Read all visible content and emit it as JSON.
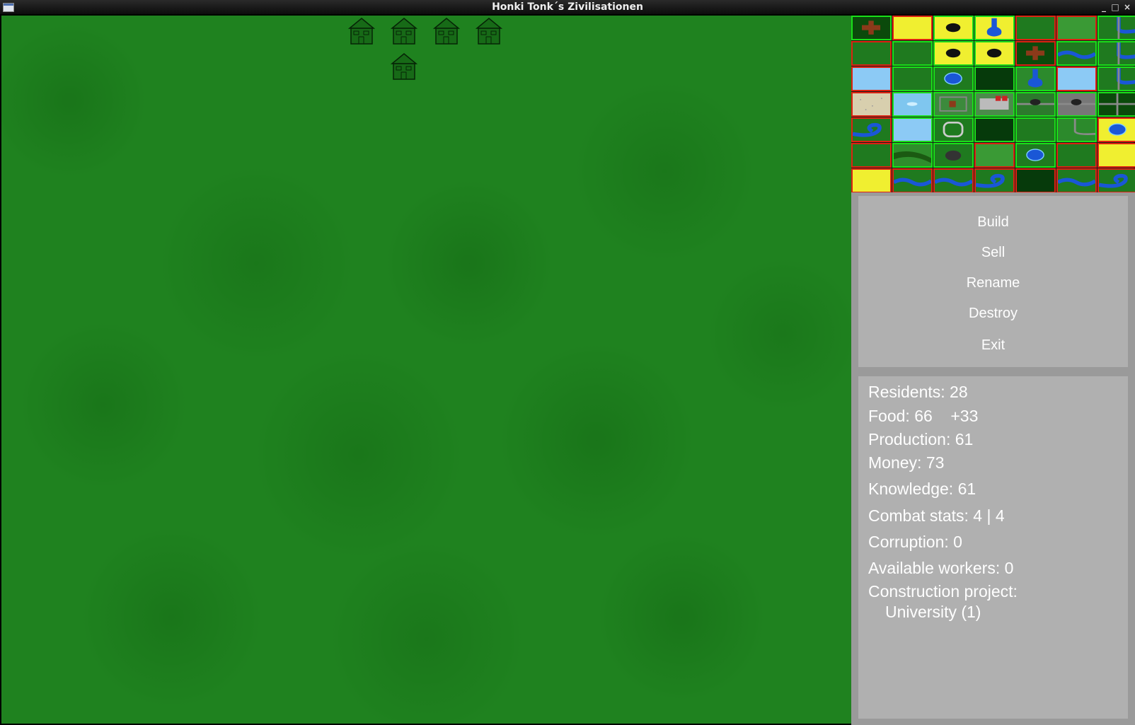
{
  "window": {
    "title": "Honki Tonk´s Zivilisationen",
    "controls": {
      "minimize": "_",
      "maximize": "□",
      "close": "×"
    }
  },
  "map": {
    "background": "#1f821f",
    "buildings": [
      {
        "icon": "house-icon"
      },
      {
        "icon": "house-icon"
      },
      {
        "icon": "house-icon"
      },
      {
        "icon": "house-icon"
      },
      {
        "icon": "house-icon"
      }
    ]
  },
  "minimap": {
    "rows": [
      [
        "cross-own",
        "sand",
        "oil",
        "lake-sand",
        "grass",
        "grass-light",
        "river-corner-own"
      ],
      [
        "grass",
        "grass",
        "oil-sand",
        "oil",
        "cross-road",
        "river",
        "river-road"
      ],
      [
        "water-light",
        "grass",
        "pond",
        "dark",
        "pond-road",
        "water-light",
        "river-end"
      ],
      [
        "sand-light",
        "fish",
        "farm",
        "factory",
        "mine-road",
        "mine-rock",
        "road-cross"
      ],
      [
        "river-curve",
        "water-light",
        "ring",
        "dark",
        "grass",
        "road-bend",
        "pond-sand"
      ],
      [
        "grass",
        "swamp",
        "mountain",
        "grass-light",
        "pond-dark",
        "grass",
        "sand"
      ],
      [
        "sand",
        "river",
        "river",
        "river-curve",
        "dark",
        "river",
        "river-curve"
      ]
    ],
    "borders": [
      [
        "own",
        "red",
        "own",
        "own",
        "red",
        "red",
        "own"
      ],
      [
        "red",
        "own",
        "own",
        "own",
        "red",
        "own",
        "own"
      ],
      [
        "red",
        "own",
        "own",
        "own",
        "own",
        "red",
        "own"
      ],
      [
        "red",
        "own",
        "own",
        "own",
        "own",
        "own",
        "own"
      ],
      [
        "red",
        "own",
        "own",
        "own",
        "own",
        "own",
        "red"
      ],
      [
        "red",
        "own",
        "own",
        "red",
        "own",
        "red",
        "red"
      ],
      [
        "red",
        "red",
        "red",
        "red",
        "red",
        "red",
        "red"
      ]
    ]
  },
  "actions": {
    "build": "Build",
    "sell": "Sell",
    "rename": "Rename",
    "destroy": "Destroy",
    "exit": "Exit"
  },
  "stats": {
    "residents": "Residents: 28",
    "food": "Food: 66    +33",
    "production": "Production: 61",
    "money": "Money: 73",
    "knowledge": "Knowledge: 61",
    "combat": "Combat stats: 4 | 4",
    "corruption": "Corruption: 0",
    "workers": "Available workers: 0",
    "construction_label": "Construction project:",
    "construction_value": "University (1)"
  }
}
